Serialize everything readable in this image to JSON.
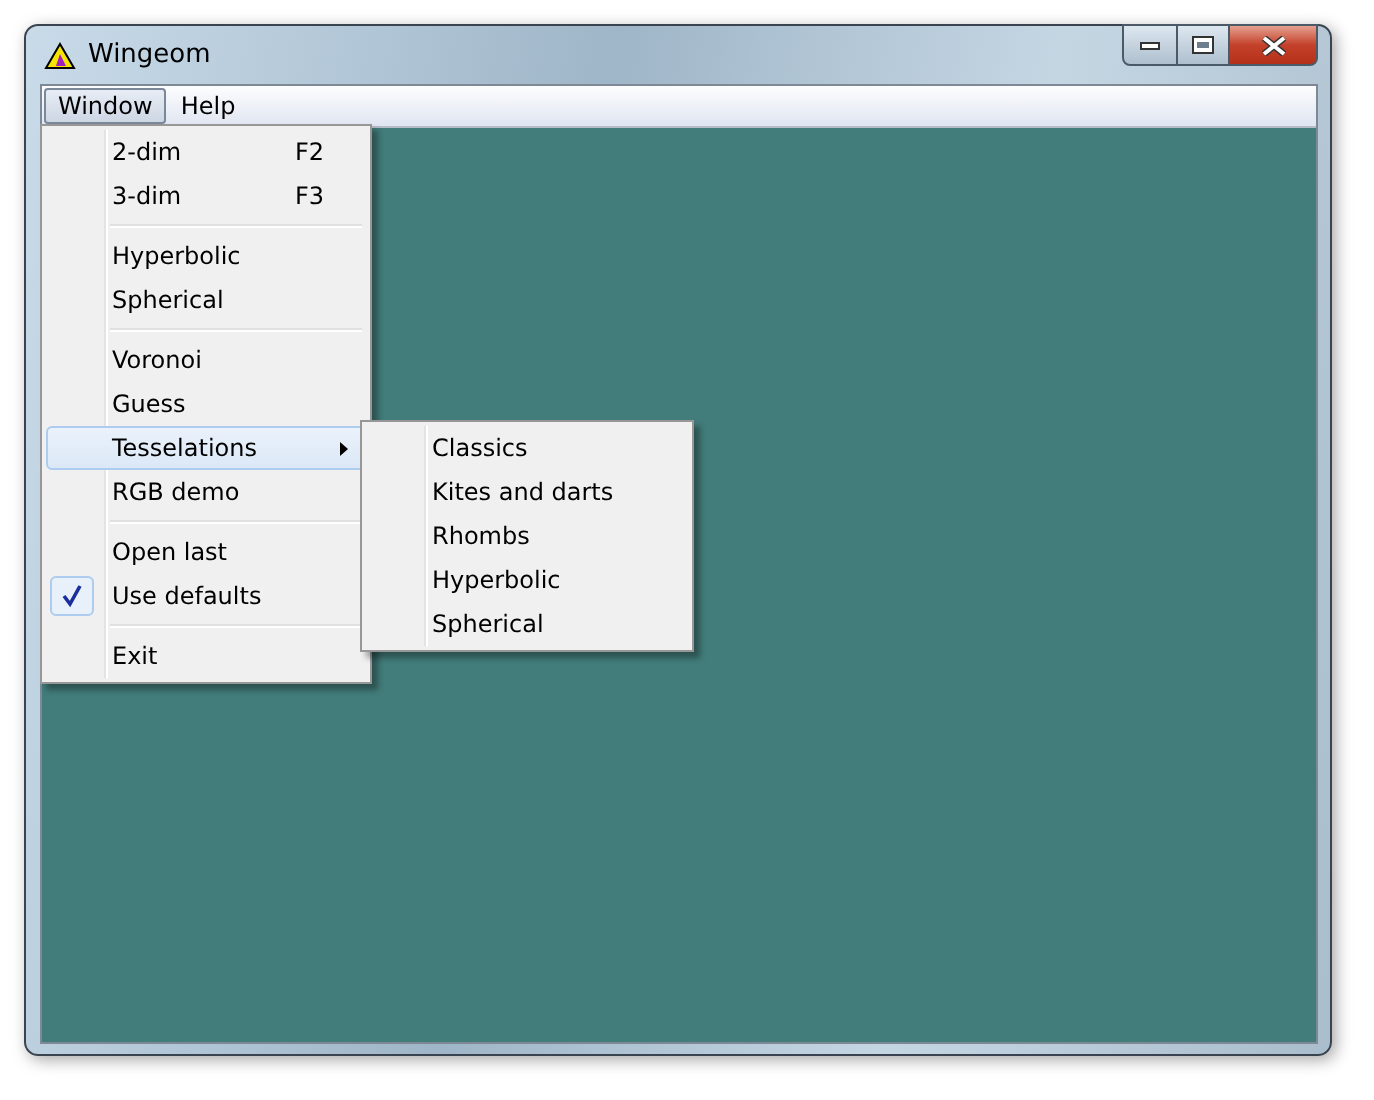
{
  "window": {
    "title": "Wingeom"
  },
  "menubar": [
    {
      "label": "Window",
      "selected": true
    },
    {
      "label": "Help",
      "selected": false
    }
  ],
  "menu": [
    {
      "kind": "item",
      "label": "2-dim",
      "shortcut": "F2",
      "checked": false,
      "selected": false,
      "submenu": false
    },
    {
      "kind": "item",
      "label": "3-dim",
      "shortcut": "F3",
      "checked": false,
      "selected": false,
      "submenu": false
    },
    {
      "kind": "separator"
    },
    {
      "kind": "item",
      "label": "Hyperbolic",
      "checked": false,
      "selected": false,
      "submenu": false
    },
    {
      "kind": "item",
      "label": "Spherical",
      "checked": false,
      "selected": false,
      "submenu": false
    },
    {
      "kind": "separator"
    },
    {
      "kind": "item",
      "label": "Voronoi",
      "checked": false,
      "selected": false,
      "submenu": false
    },
    {
      "kind": "item",
      "label": "Guess",
      "checked": false,
      "selected": false,
      "submenu": false
    },
    {
      "kind": "item",
      "label": "Tesselations",
      "checked": false,
      "selected": true,
      "submenu": true
    },
    {
      "kind": "item",
      "label": "RGB demo",
      "checked": false,
      "selected": false,
      "submenu": false
    },
    {
      "kind": "separator"
    },
    {
      "kind": "item",
      "label": "Open last",
      "checked": false,
      "selected": false,
      "submenu": false
    },
    {
      "kind": "item",
      "label": "Use defaults",
      "checked": true,
      "selected": false,
      "submenu": false
    },
    {
      "kind": "separator"
    },
    {
      "kind": "item",
      "label": "Exit",
      "checked": false,
      "selected": false,
      "submenu": false
    }
  ],
  "submenu": [
    {
      "label": "Classics"
    },
    {
      "label": "Kites and darts"
    },
    {
      "label": "Rhombs"
    },
    {
      "label": "Hyperbolic"
    },
    {
      "label": "Spherical"
    }
  ]
}
